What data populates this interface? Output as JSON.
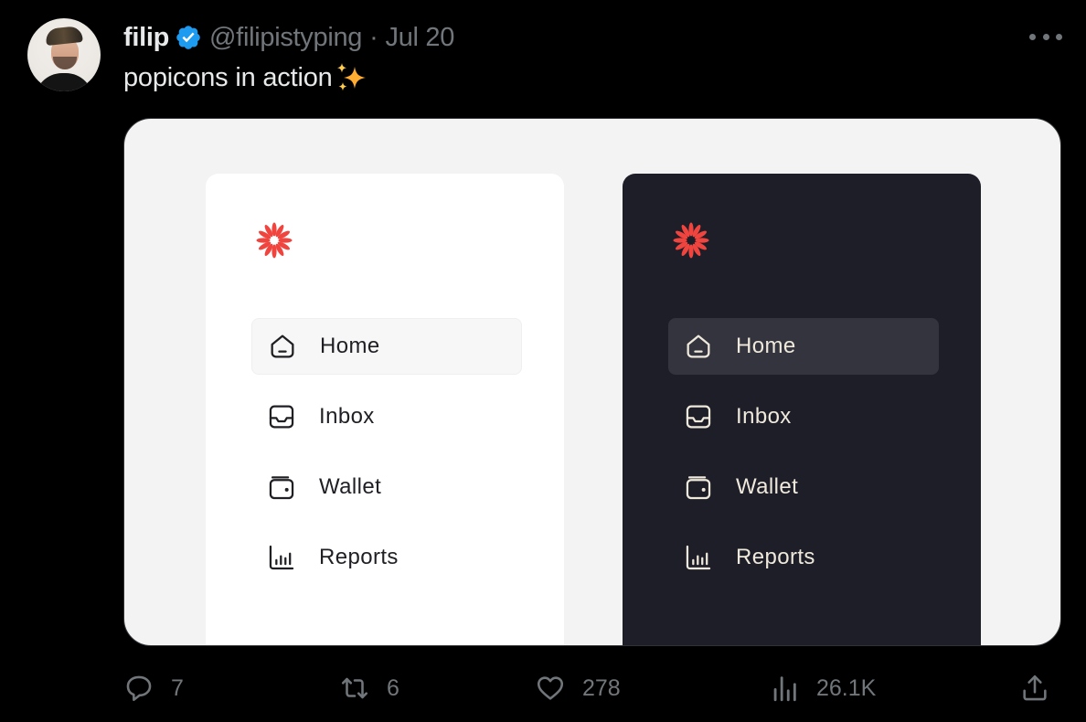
{
  "tweet": {
    "author_name": "filip",
    "verified": true,
    "handle": "@filipistyping",
    "separator": "·",
    "date": "Jul 20",
    "text": "popicons in action",
    "emoji": "sparkles",
    "more_icon": "more-horizontal-icon"
  },
  "media": {
    "background_color": "#f3f3f3",
    "panels": [
      {
        "theme": "light",
        "background": "#ffffff",
        "logo_color": "#f0453f",
        "items": [
          {
            "label": "Home",
            "icon": "home-icon",
            "active": true
          },
          {
            "label": "Inbox",
            "icon": "inbox-icon",
            "active": false
          },
          {
            "label": "Wallet",
            "icon": "wallet-icon",
            "active": false
          },
          {
            "label": "Reports",
            "icon": "reports-icon",
            "active": false
          }
        ]
      },
      {
        "theme": "dark",
        "background": "#1e1e28",
        "logo_color": "#f0453f",
        "items": [
          {
            "label": "Home",
            "icon": "home-icon",
            "active": true
          },
          {
            "label": "Inbox",
            "icon": "inbox-icon",
            "active": false
          },
          {
            "label": "Wallet",
            "icon": "wallet-icon",
            "active": false
          },
          {
            "label": "Reports",
            "icon": "reports-icon",
            "active": false
          }
        ]
      }
    ]
  },
  "actions": {
    "replies": "7",
    "reposts": "6",
    "likes": "278",
    "views": "26.1K"
  },
  "colors": {
    "verified_blue": "#1d9bf0",
    "muted": "#71767b",
    "text": "#e7e9ea",
    "accent_red": "#f0453f"
  }
}
